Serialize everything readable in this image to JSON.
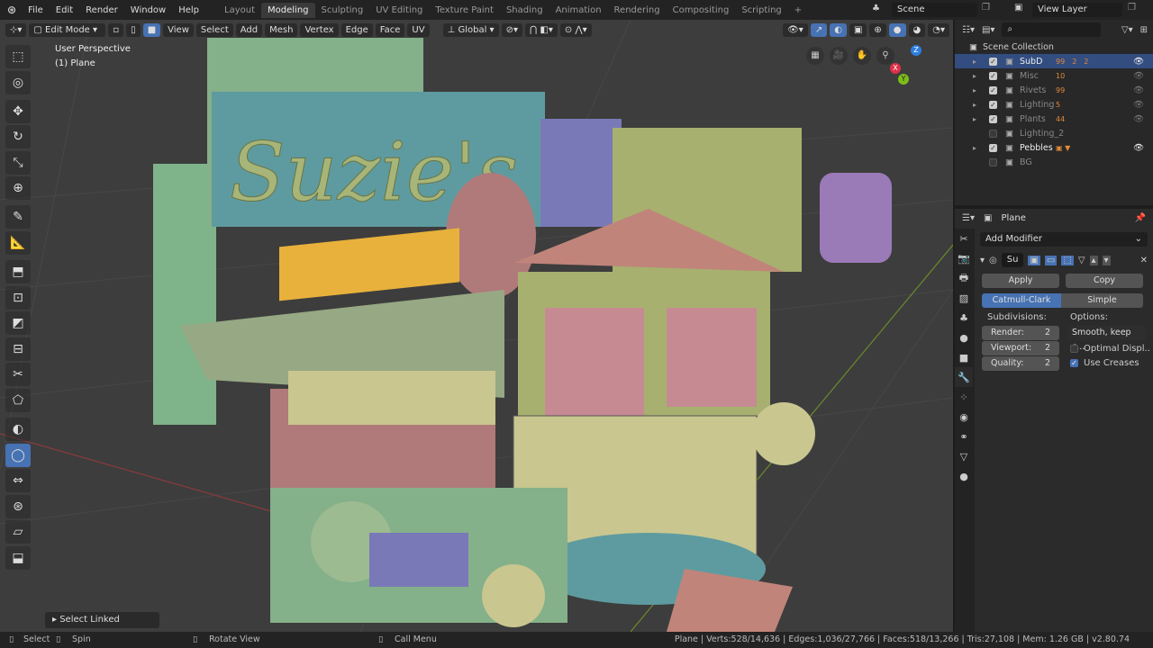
{
  "topbar": {
    "menus": [
      "File",
      "Edit",
      "Render",
      "Window",
      "Help"
    ],
    "workspaces": [
      "Layout",
      "Modeling",
      "Sculpting",
      "UV Editing",
      "Texture Paint",
      "Shading",
      "Animation",
      "Rendering",
      "Compositing",
      "Scripting"
    ],
    "active_workspace": "Modeling",
    "add_tab": "+",
    "scene": "Scene",
    "view_layer": "View Layer"
  },
  "viewport_header": {
    "mode": "Edit Mode",
    "menus": [
      "View",
      "Select",
      "Add",
      "Mesh",
      "Vertex",
      "Edge",
      "Face",
      "UV"
    ],
    "orientation": "Global"
  },
  "viewport": {
    "perspective": "User Perspective",
    "object": "(1) Plane",
    "last_op": "Select Linked",
    "gizmo": {
      "x": "X",
      "y": "Y",
      "z": "Z"
    }
  },
  "toolbar": {
    "tools": [
      "select-box",
      "cursor",
      "move",
      "rotate",
      "scale",
      "transform",
      "annotate",
      "measure",
      "extrude",
      "inset",
      "bevel",
      "loop-cut",
      "knife",
      "poly-build",
      "spin",
      "smooth",
      "edge-slide",
      "shrink-fatten",
      "shear",
      "rip-region"
    ],
    "active_index": 15
  },
  "outliner": {
    "root": "Scene Collection",
    "items": [
      {
        "name": "SubD",
        "checked": true,
        "selected": true,
        "badges": [
          "99",
          "2",
          "2"
        ]
      },
      {
        "name": "Misc",
        "checked": true,
        "badges": [
          "10"
        ]
      },
      {
        "name": "Rivets",
        "checked": true,
        "badges": [
          "99"
        ]
      },
      {
        "name": "Lighting",
        "checked": true,
        "badges": [
          "5"
        ]
      },
      {
        "name": "Plants",
        "checked": true,
        "badges": [
          "44"
        ]
      },
      {
        "name": "Lighting_2",
        "checked": false,
        "badges": []
      },
      {
        "name": "Pebbles",
        "checked": true,
        "badges": []
      },
      {
        "name": "BG",
        "checked": false,
        "badges": []
      }
    ]
  },
  "properties": {
    "object": "Plane",
    "add_modifier": "Add Modifier",
    "modifier_name": "Su",
    "apply": "Apply",
    "copy": "Copy",
    "catmull": "Catmull-Clark",
    "simple": "Simple",
    "subdivisions_label": "Subdivisions:",
    "options_label": "Options:",
    "render_label": "Render:",
    "render_value": "2",
    "viewport_label": "Viewport:",
    "viewport_value": "2",
    "quality_label": "Quality:",
    "quality_value": "2",
    "uv_smooth": "Smooth, keep c...",
    "optimal_display": "Optimal Displ..",
    "optimal_display_checked": false,
    "use_creases": "Use Creases",
    "use_creases_checked": true,
    "accent": "#4772b3"
  },
  "status": {
    "select": "Select",
    "spin": "Spin",
    "rotate": "Rotate View",
    "call_menu": "Call Menu",
    "stats": "Plane | Verts:528/14,636 | Edges:1,036/27,766 | Faces:518/13,266 | Tris:27,108 | Mem: 1.26 GB | v2.80.74"
  }
}
